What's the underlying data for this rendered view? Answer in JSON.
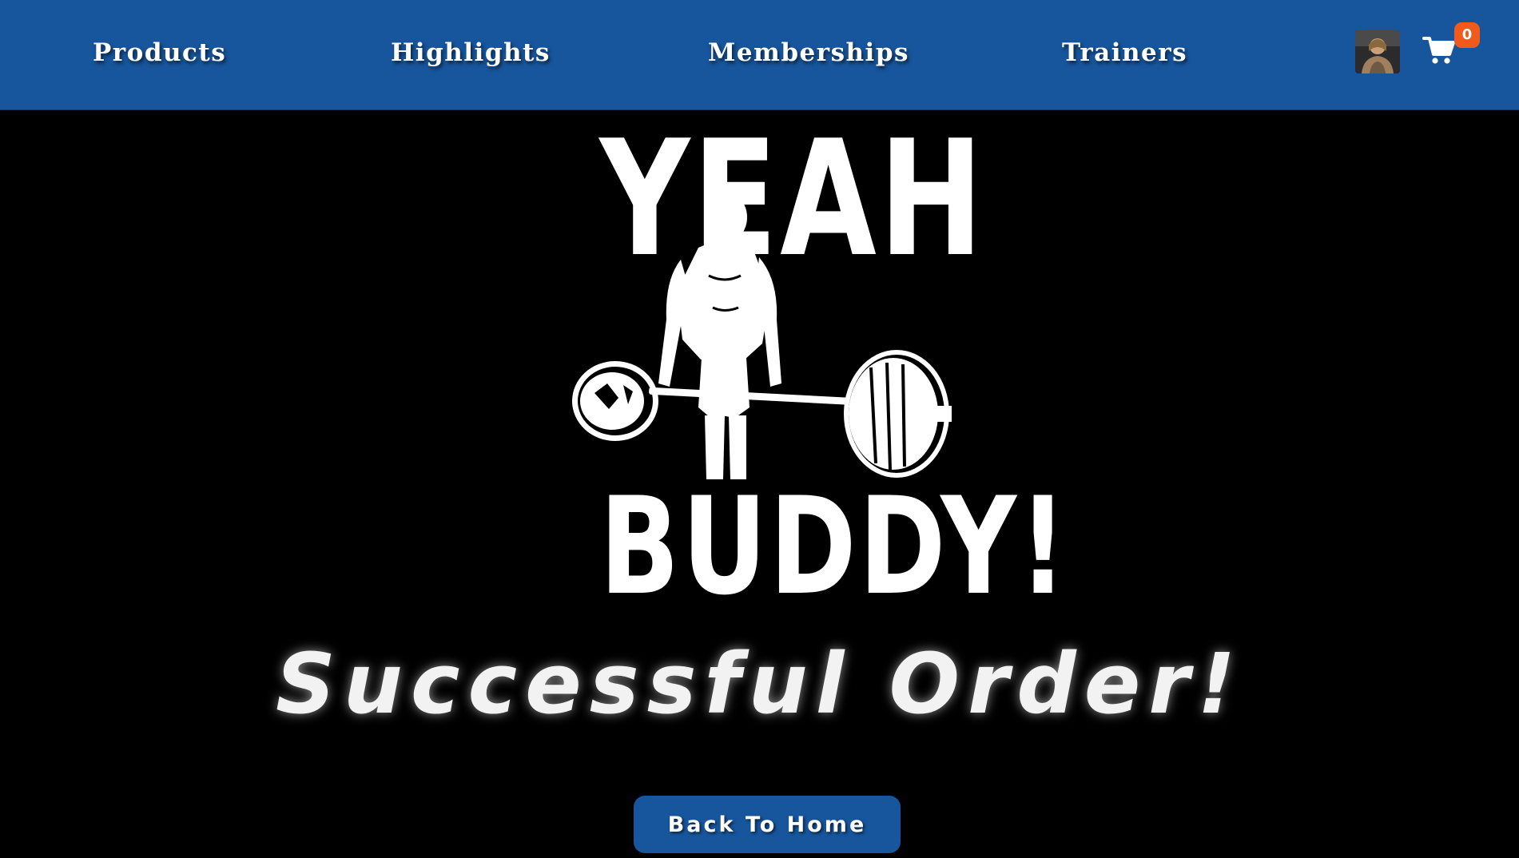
{
  "nav": {
    "items": [
      {
        "label": "Products"
      },
      {
        "label": "Highlights"
      },
      {
        "label": "Memberships"
      },
      {
        "label": "Trainers"
      }
    ],
    "avatar_icon": "user-avatar",
    "cart_icon": "shopping-cart-icon",
    "cart_count": "0"
  },
  "hero": {
    "logo_top": "YEAH",
    "logo_bottom": "BUDDY!",
    "logo_figure": "deadlift-silhouette"
  },
  "main": {
    "headline": "Successful Order!",
    "button_label": "Back To Home"
  },
  "colors": {
    "nav_background": "#17559c",
    "page_background": "#000000",
    "badge": "#f15a1a",
    "button": "#17559c",
    "text": "#ffffff"
  }
}
